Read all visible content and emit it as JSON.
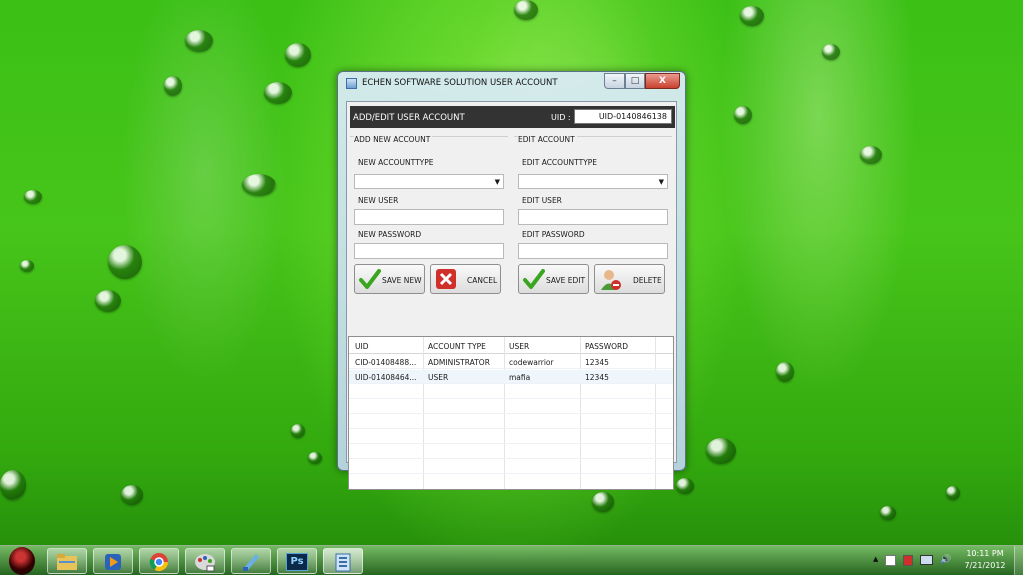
{
  "window": {
    "title": "ECHEN SOFTWARE SOLUTION USER ACCOUNT",
    "controls": {
      "minimize": "–",
      "maximize": "□",
      "close": "X"
    }
  },
  "header": {
    "title": "ADD/EDIT USER ACCOUNT",
    "uid_label": "UID :",
    "uid_value": "UID-0140846138"
  },
  "add": {
    "group_label": "ADD NEW ACCOUNT",
    "accounttype_label": "NEW ACCOUNTTYPE",
    "accounttype_value": "",
    "user_label": "NEW USER",
    "user_value": "",
    "password_label": "NEW PASSWORD",
    "password_value": "",
    "save_label": "SAVE NEW",
    "cancel_label": "CANCEL"
  },
  "edit": {
    "group_label": "EDIT ACCOUNT",
    "accounttype_label": "EDIT ACCOUNTTYPE",
    "accounttype_value": "",
    "user_label": "EDIT USER",
    "user_value": "",
    "password_label": "EDIT PASSWORD",
    "password_value": "",
    "save_label": "SAVE EDIT",
    "delete_label": "DELETE"
  },
  "grid": {
    "columns": [
      "UID",
      "ACCOUNT TYPE",
      "USER",
      "PASSWORD"
    ],
    "rows": [
      [
        "CID-01408488...",
        "ADMINISTRATOR",
        "codewarrior",
        "12345"
      ],
      [
        "UID-01408464...",
        "USER",
        "mafia",
        "12345"
      ]
    ]
  },
  "taskbar": {
    "apps": [
      "explorer-icon",
      "media-player-icon",
      "chrome-icon",
      "paint-icon",
      "notepad-icon",
      "photoshop-icon",
      "app-icon"
    ],
    "photoshop_label": "Ps",
    "tray": {
      "expand": "▲",
      "volume": "🔊"
    },
    "time": "10:11 PM",
    "date": "7/21/2012"
  },
  "colors": {
    "accent": "#333333",
    "wallpaper": "#47c51a",
    "check": "#3aa51f",
    "cancel": "#d0302a"
  }
}
